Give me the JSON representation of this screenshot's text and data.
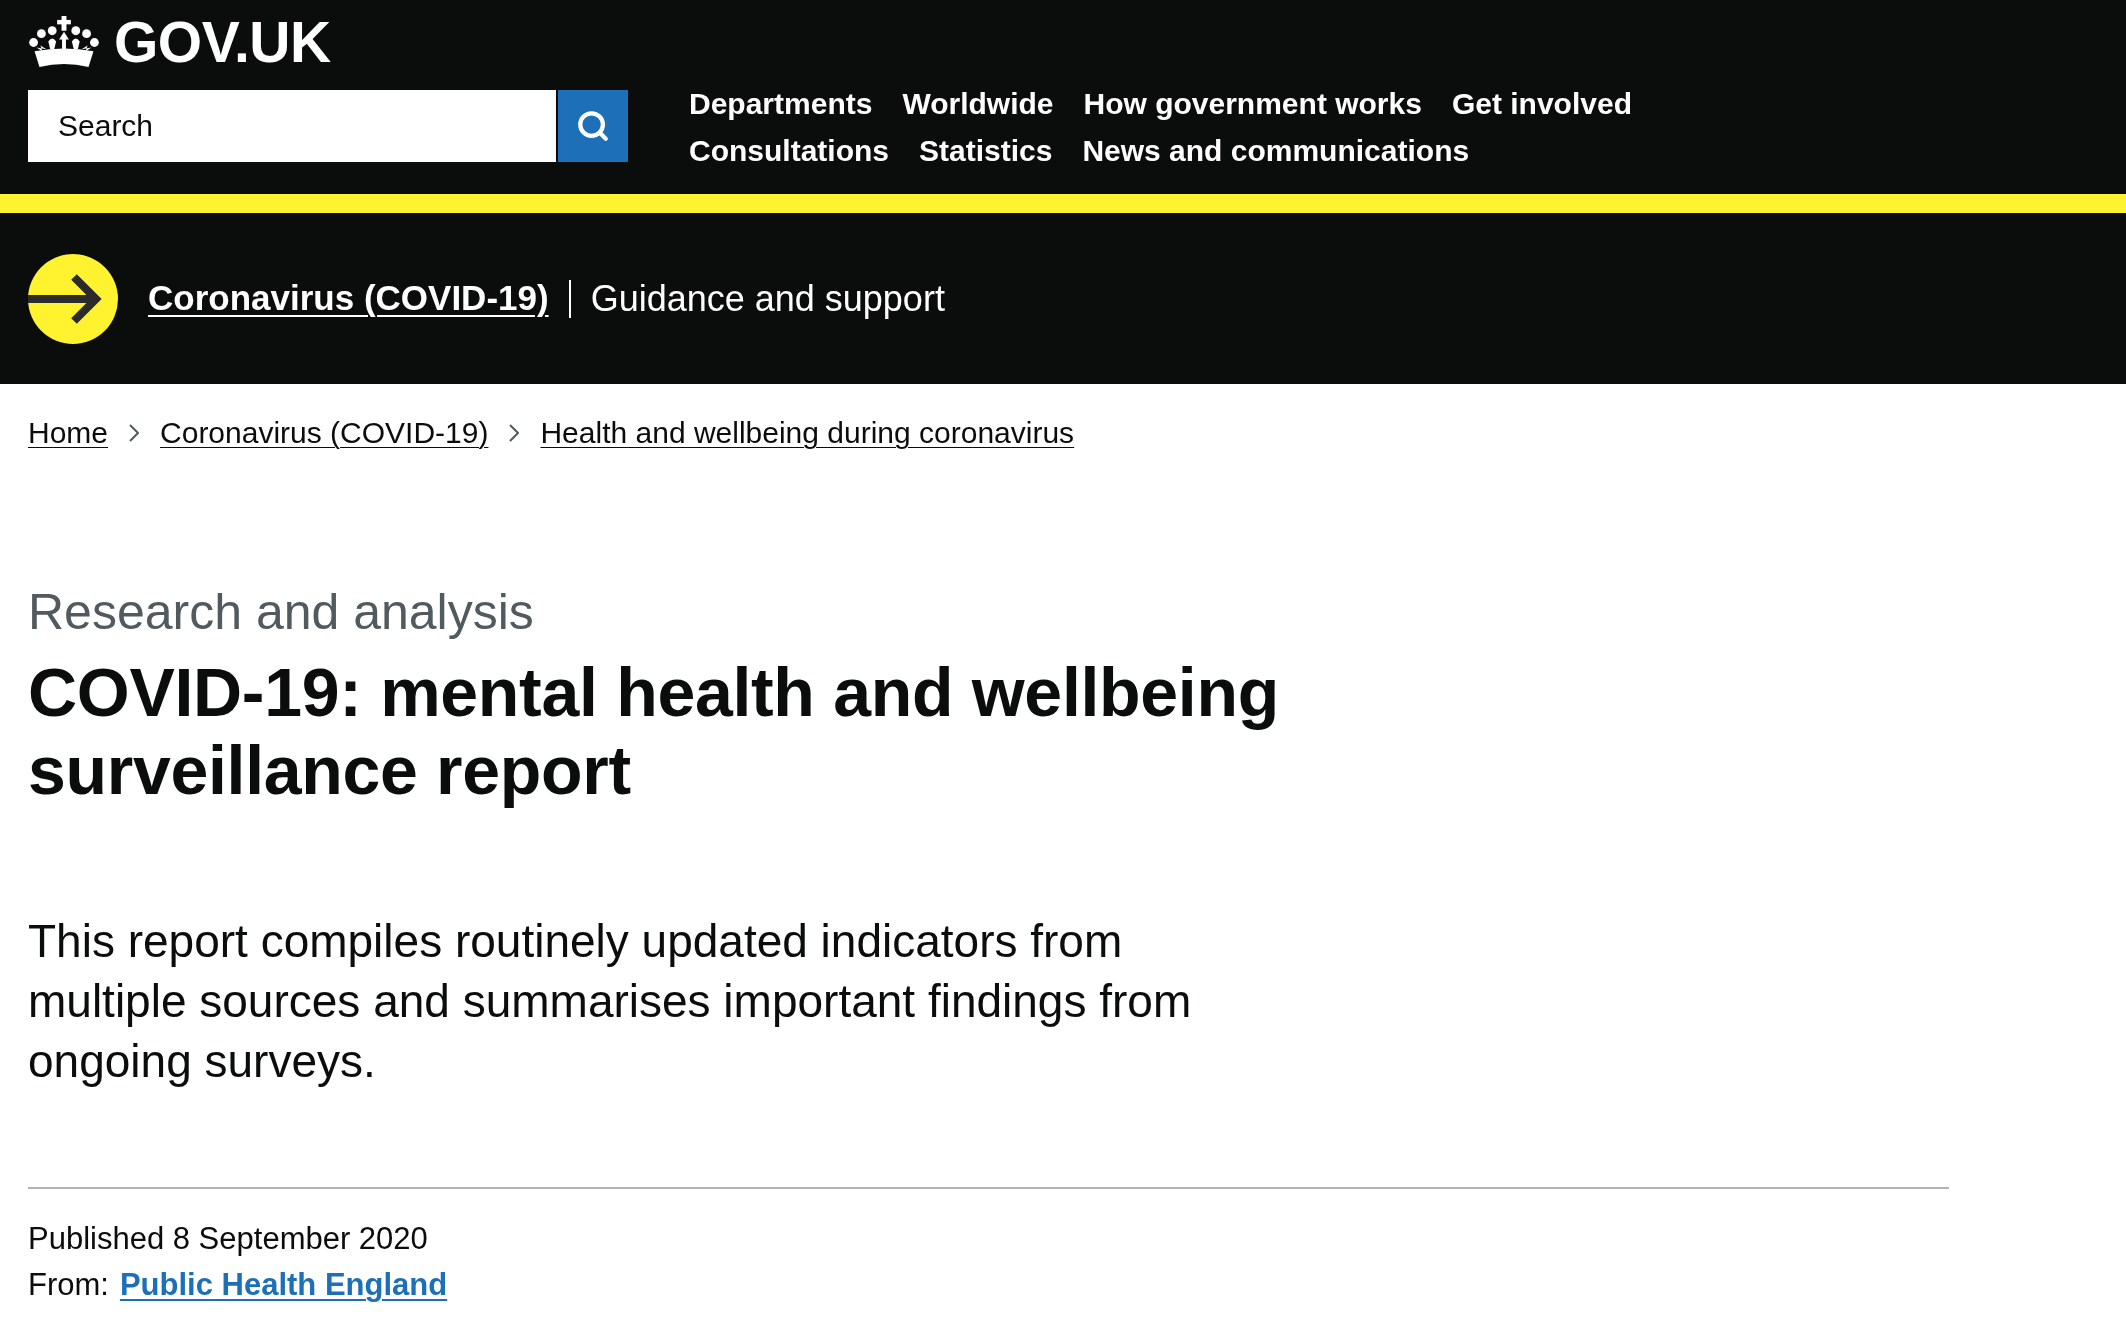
{
  "header": {
    "logo": "GOV.UK",
    "search": {
      "placeholder": "Search"
    },
    "nav": [
      "Departments",
      "Worldwide",
      "How government works",
      "Get involved",
      "Consultations",
      "Statistics",
      "News and communications"
    ]
  },
  "banner": {
    "link": "Coronavirus (COVID-19)",
    "tagline": "Guidance and support"
  },
  "breadcrumbs": [
    "Home",
    "Coronavirus (COVID-19)",
    "Health and wellbeing during coronavirus"
  ],
  "page": {
    "caption": "Research and analysis",
    "title": "COVID-19: mental health and wellbeing surveillance report",
    "description": "This report compiles routinely updated indicators from multiple sources and summarises important findings from ongoing surveys.",
    "published": "Published 8 September 2020",
    "from_label": "From:",
    "from_link": "Public Health England"
  }
}
